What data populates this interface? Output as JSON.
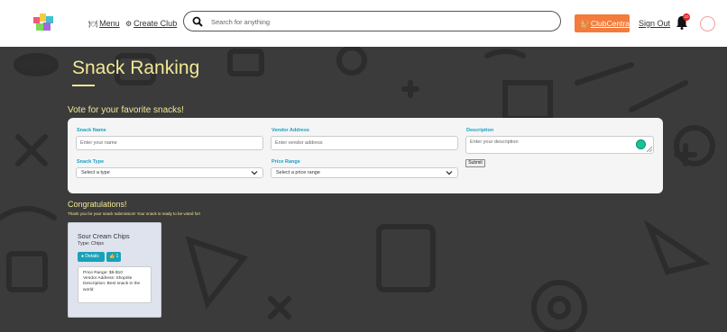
{
  "nav": {
    "menu_label": "Menu",
    "create_club_label": "Create Club",
    "search_placeholder": "Search for anything",
    "club_central_label": "ClubCentral",
    "sign_out_label": "Sign Out",
    "notification_count": "10"
  },
  "page": {
    "title": "Snack Ranking",
    "vote_heading": "Vote for your favorite snacks!"
  },
  "form": {
    "snack_name_label": "Snack Name",
    "snack_name_placeholder": "Enter your name",
    "vendor_address_label": "Vendor Address",
    "vendor_address_placeholder": "Enter vendor address",
    "description_label": "Description",
    "description_placeholder": "Enter your description",
    "snack_type_label": "Snack Type",
    "snack_type_selected": "Select a type",
    "price_range_label": "Price Range",
    "price_range_selected": "Select a price range",
    "submit_label": "Submit"
  },
  "result": {
    "heading": "Congratulations!",
    "message": "Thank you for your snack submission! Your snack is ready to be voted for!"
  },
  "card": {
    "name": "Sour Cream Chips",
    "type": "Type: Chips",
    "details_label": "Details",
    "likes": "1",
    "price_range": "Price Range: $6-$10",
    "vendor_address": "Vendor Address: Shoprite",
    "description": "Description: Best snack in the world"
  },
  "colors": {
    "accent_yellow": "#f2e896",
    "label_blue": "#1a9fc4",
    "button_teal": "#17a2b8",
    "club_orange": "#f47b3b",
    "background": "#3b3b3b"
  }
}
